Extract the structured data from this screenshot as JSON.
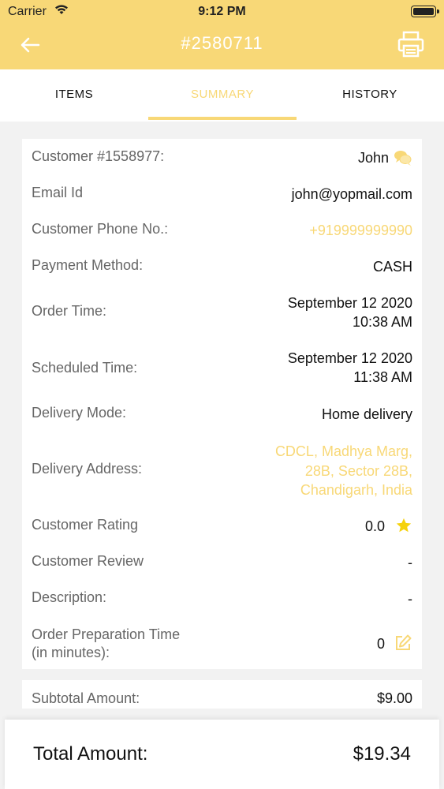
{
  "status_bar": {
    "carrier": "Carrier",
    "time": "9:12 PM"
  },
  "header": {
    "title": "#2580711"
  },
  "tabs": [
    {
      "label": "ITEMS",
      "active": false
    },
    {
      "label": "SUMMARY",
      "active": true
    },
    {
      "label": "HISTORY",
      "active": false
    }
  ],
  "summary": {
    "customer": {
      "label": "Customer #1558977:",
      "value": "John"
    },
    "email": {
      "label": "Email Id",
      "value": "john@yopmail.com"
    },
    "phone": {
      "label": "Customer Phone No.:",
      "value": "+919999999990"
    },
    "payment": {
      "label": "Payment Method:",
      "value": "CASH"
    },
    "order_time": {
      "label": "Order Time:",
      "date": "September 12 2020",
      "time": "10:38 AM"
    },
    "scheduled_time": {
      "label": "Scheduled Time:",
      "date": "September 12 2020",
      "time": "11:38 AM"
    },
    "delivery_mode": {
      "label": "Delivery Mode:",
      "value": "Home delivery"
    },
    "delivery_address": {
      "label": "Delivery Address:",
      "line1": "CDCL, Madhya Marg,",
      "line2": "28B, Sector 28B,",
      "line3": "Chandigarh, India"
    },
    "rating": {
      "label": "Customer Rating",
      "value": "0.0"
    },
    "review": {
      "label": "Customer Review",
      "value": "-"
    },
    "description": {
      "label": "Description:",
      "value": "-"
    },
    "prep_time": {
      "label_line1": "Order Preparation Time",
      "label_line2": "(in minutes):",
      "value": "0"
    }
  },
  "subtotal": {
    "label": "Subtotal Amount:",
    "value": "$9.00"
  },
  "total": {
    "label": "Total Amount:",
    "value": "$19.34"
  },
  "colors": {
    "accent": "#f8d877",
    "star": "#f5d20b",
    "label_gray": "#666666"
  },
  "icons": [
    "wifi-icon",
    "battery-icon",
    "back-arrow-icon",
    "print-icon",
    "chat-icon",
    "star-icon",
    "edit-icon"
  ]
}
